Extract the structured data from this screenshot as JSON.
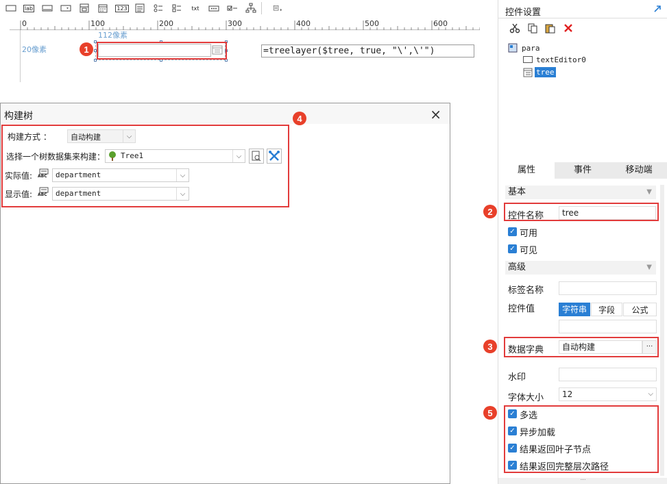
{
  "toolbar": {
    "icons": [
      "textbox-icon",
      "label-icon",
      "button-icon",
      "combo-icon",
      "tree-combo-icon",
      "date-icon",
      "number-icon",
      "textarea-icon",
      "radio-group-icon",
      "checkbox-group-icon",
      "text-icon",
      "password-icon",
      "checkbox-icon",
      "tree-icon",
      "more-icon"
    ],
    "lab": "lab",
    "num": "123",
    "txt": "txt"
  },
  "ruler": {
    "ticks": [
      "0",
      "100",
      "200",
      "300",
      "400",
      "500",
      "600"
    ]
  },
  "canvas": {
    "width_hint": "112像素",
    "height_hint": "20像素",
    "formula": "=treelayer($tree, true, \"\\',\\'\")"
  },
  "badges": [
    "1",
    "2",
    "3",
    "4",
    "5"
  ],
  "dialog": {
    "title": "构建树",
    "close": "×",
    "build_method_label": "构建方式 ：",
    "build_method_value": "自动构建",
    "dataset_label": "选择一个树数据集来构建：",
    "dataset_value": "Tree1",
    "actual_label": "实际值:",
    "actual_value": "department",
    "display_label": "显示值:",
    "display_value": "department",
    "abc": "ABC"
  },
  "panel": {
    "title": "控件设置",
    "tree_root": "para",
    "tree_child1": "textEditor0",
    "tree_child2": "tree",
    "tabs": [
      "属性",
      "事件",
      "移动端"
    ],
    "basic_section": "基本",
    "name_label": "控件名称",
    "name_value": "tree",
    "enabled_label": "可用",
    "visible_label": "可见",
    "advanced_section": "高级",
    "tag_label": "标签名称",
    "value_label": "控件值",
    "value_modes": [
      "字符串",
      "字段",
      "公式"
    ],
    "dict_label": "数据字典",
    "dict_value": "自动构建",
    "dict_more": "···",
    "watermark_label": "水印",
    "fontsize_label": "字体大小",
    "fontsize_value": "12",
    "multi_label": "多选",
    "async_label": "异步加载",
    "leaf_label": "结果返回叶子节点",
    "path_label": "结果返回完整层次路径"
  },
  "colors": {
    "accent": "#2a7fd4",
    "highlight": "#e23b3b"
  }
}
